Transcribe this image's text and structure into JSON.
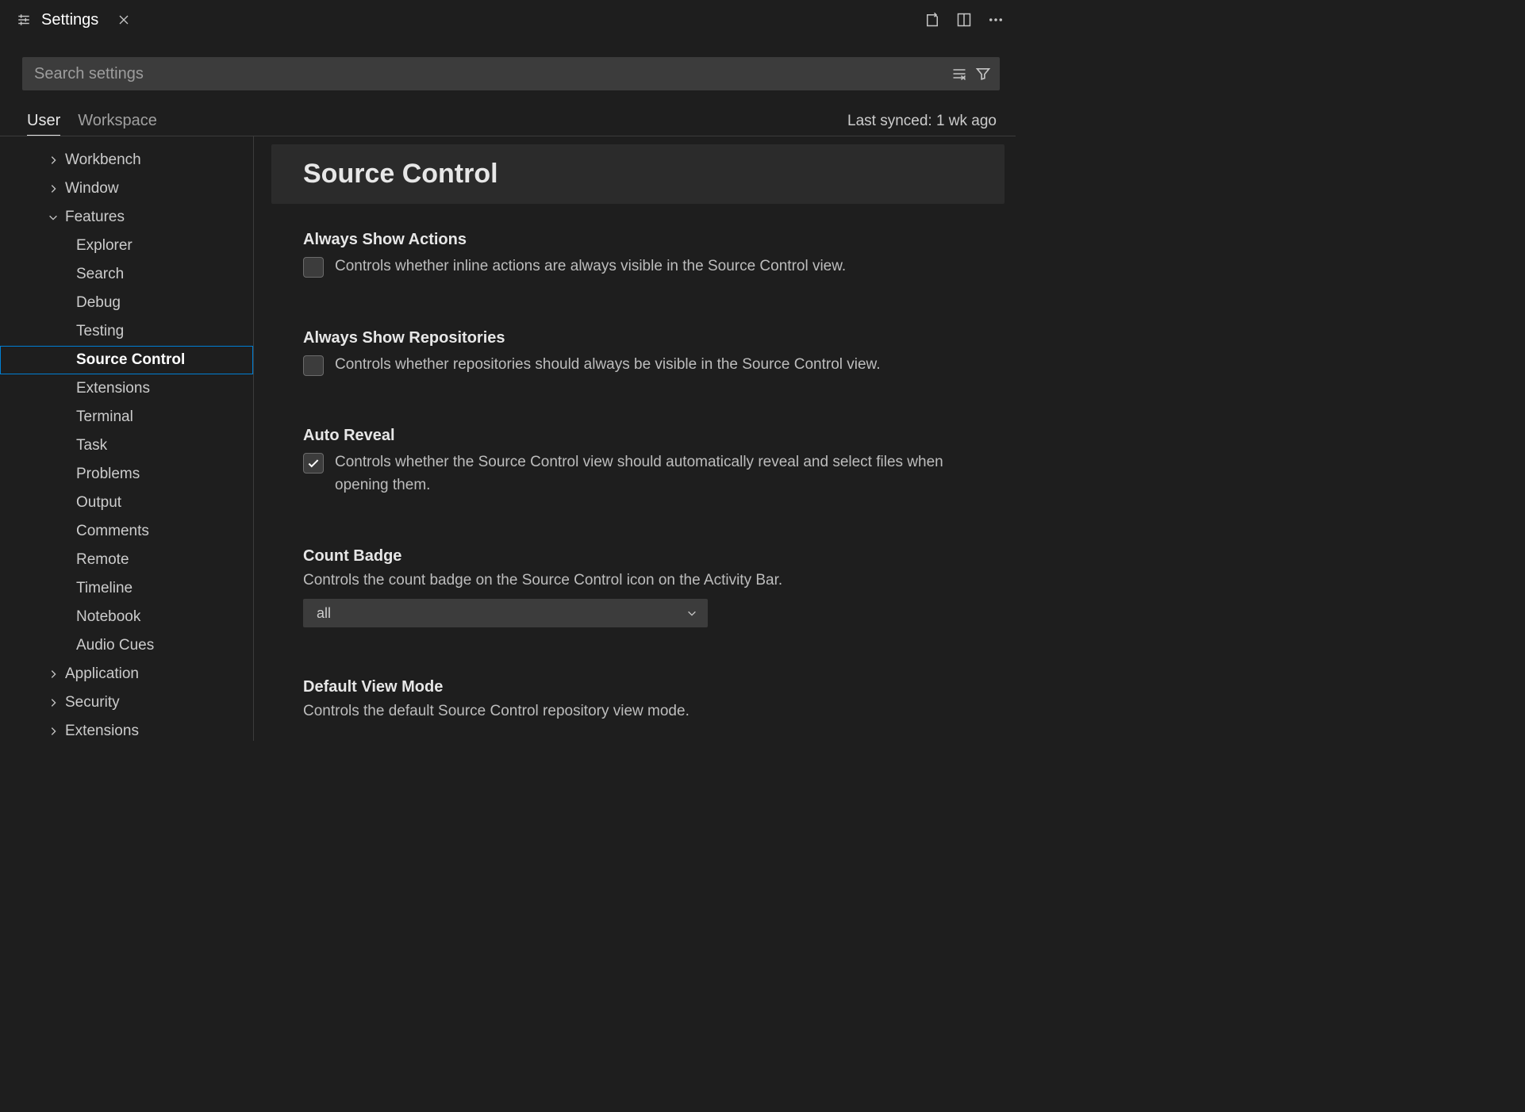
{
  "titlebar": {
    "tab_label": "Settings"
  },
  "search": {
    "placeholder": "Search settings"
  },
  "scope": {
    "tabs": [
      "User",
      "Workspace"
    ],
    "active": "User",
    "sync_status": "Last synced: 1 wk ago"
  },
  "tree": {
    "items": [
      {
        "label": "Workbench",
        "level": 0,
        "chevron": "right"
      },
      {
        "label": "Window",
        "level": 0,
        "chevron": "right"
      },
      {
        "label": "Features",
        "level": 0,
        "chevron": "down"
      },
      {
        "label": "Explorer",
        "level": 1
      },
      {
        "label": "Search",
        "level": 1
      },
      {
        "label": "Debug",
        "level": 1
      },
      {
        "label": "Testing",
        "level": 1
      },
      {
        "label": "Source Control",
        "level": 1,
        "selected": true
      },
      {
        "label": "Extensions",
        "level": 1
      },
      {
        "label": "Terminal",
        "level": 1
      },
      {
        "label": "Task",
        "level": 1
      },
      {
        "label": "Problems",
        "level": 1
      },
      {
        "label": "Output",
        "level": 1
      },
      {
        "label": "Comments",
        "level": 1
      },
      {
        "label": "Remote",
        "level": 1
      },
      {
        "label": "Timeline",
        "level": 1
      },
      {
        "label": "Notebook",
        "level": 1
      },
      {
        "label": "Audio Cues",
        "level": 1
      },
      {
        "label": "Application",
        "level": 0,
        "chevron": "right"
      },
      {
        "label": "Security",
        "level": 0,
        "chevron": "right"
      },
      {
        "label": "Extensions",
        "level": 0,
        "chevron": "right"
      }
    ]
  },
  "content": {
    "header": "Source Control",
    "settings": [
      {
        "type": "checkbox",
        "title": "Always Show Actions",
        "desc": "Controls whether inline actions are always visible in the Source Control view.",
        "checked": false
      },
      {
        "type": "checkbox",
        "title": "Always Show Repositories",
        "desc": "Controls whether repositories should always be visible in the Source Control view.",
        "checked": false
      },
      {
        "type": "checkbox",
        "title": "Auto Reveal",
        "desc": "Controls whether the Source Control view should automatically reveal and select files when opening them.",
        "checked": true
      },
      {
        "type": "dropdown",
        "title": "Count Badge",
        "desc": "Controls the count badge on the Source Control icon on the Activity Bar.",
        "value": "all"
      },
      {
        "type": "dropdown",
        "title": "Default View Mode",
        "desc": "Controls the default Source Control repository view mode.",
        "value": ""
      }
    ]
  }
}
